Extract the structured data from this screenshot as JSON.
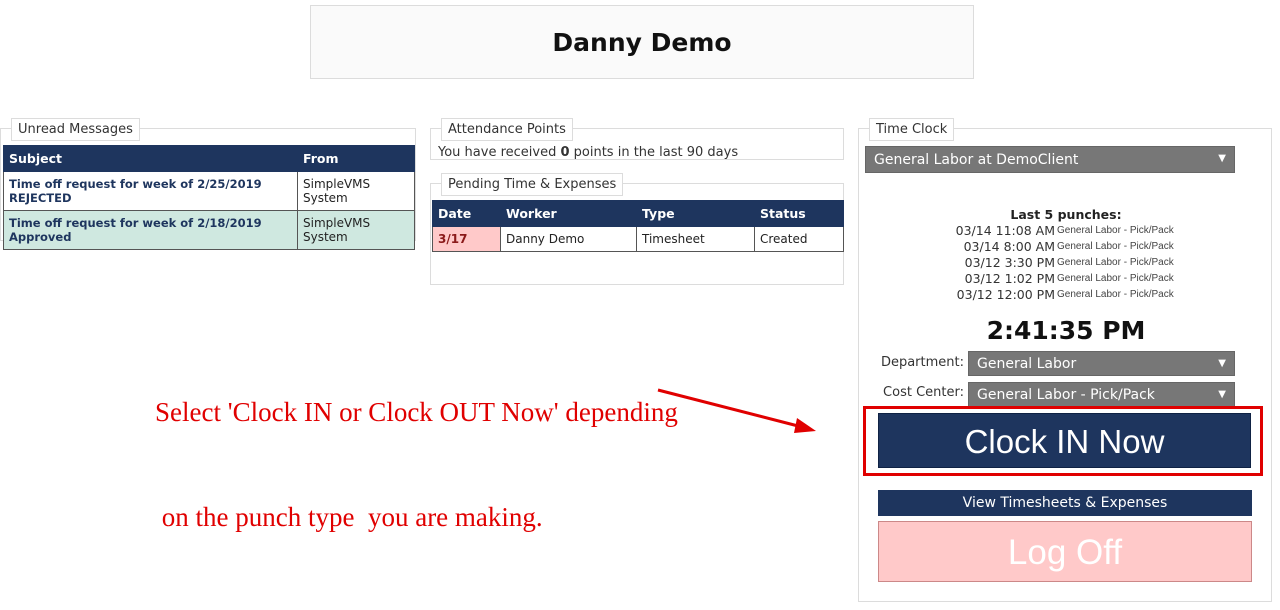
{
  "header": {
    "title": "Danny Demo"
  },
  "messages": {
    "legend": "Unread Messages",
    "headers": [
      "Subject",
      "From"
    ],
    "rows": [
      {
        "subject": "Time off request for week of 2/25/2019 REJECTED",
        "from": "SimpleVMS System",
        "status": "rejected"
      },
      {
        "subject": "Time off request for week of 2/18/2019 Approved",
        "from": "SimpleVMS System",
        "status": "approved"
      }
    ]
  },
  "attendance": {
    "legend": "Attendance Points",
    "text_prefix": "You have received",
    "points": "0",
    "text_suffix": "points in the last 90 days"
  },
  "pending": {
    "legend": "Pending Time & Expenses",
    "headers": [
      "Date",
      "Worker",
      "Type",
      "Status"
    ],
    "rows": [
      {
        "date": "3/17",
        "worker": "Danny Demo",
        "type": "Timesheet",
        "status": "Created"
      }
    ]
  },
  "timeclock": {
    "legend": "Time Clock",
    "assignment": "General Labor at DemoClient",
    "punches_title": "Last 5 punches:",
    "punches": [
      {
        "time": "03/14 11:08 AM",
        "dept": "General Labor - Pick/Pack"
      },
      {
        "time": "03/14 8:00 AM",
        "dept": "General Labor - Pick/Pack"
      },
      {
        "time": "03/12 3:30 PM",
        "dept": "General Labor - Pick/Pack"
      },
      {
        "time": "03/12 1:02 PM",
        "dept": "General Labor - Pick/Pack"
      },
      {
        "time": "03/12 12:00 PM",
        "dept": "General Labor - Pick/Pack"
      }
    ],
    "current_time": "2:41:35 PM",
    "department_label": "Department:",
    "department_value": "General Labor",
    "cost_center_label": "Cost Center:",
    "cost_center_value": "General Labor - Pick/Pack",
    "clock_in_label": "Clock IN Now",
    "view_timesheets_label": "View Timesheets & Expenses",
    "log_off_label": "Log Off"
  },
  "annotation": {
    "line1": "Select 'Clock IN or Clock OUT Now' depending",
    "line2": " on the punch type  you are making."
  },
  "colors": {
    "navy": "#1e355e",
    "annotation_red": "#e00000",
    "approved_row": "#cfe8e0",
    "pink": "#ffc9c9"
  }
}
